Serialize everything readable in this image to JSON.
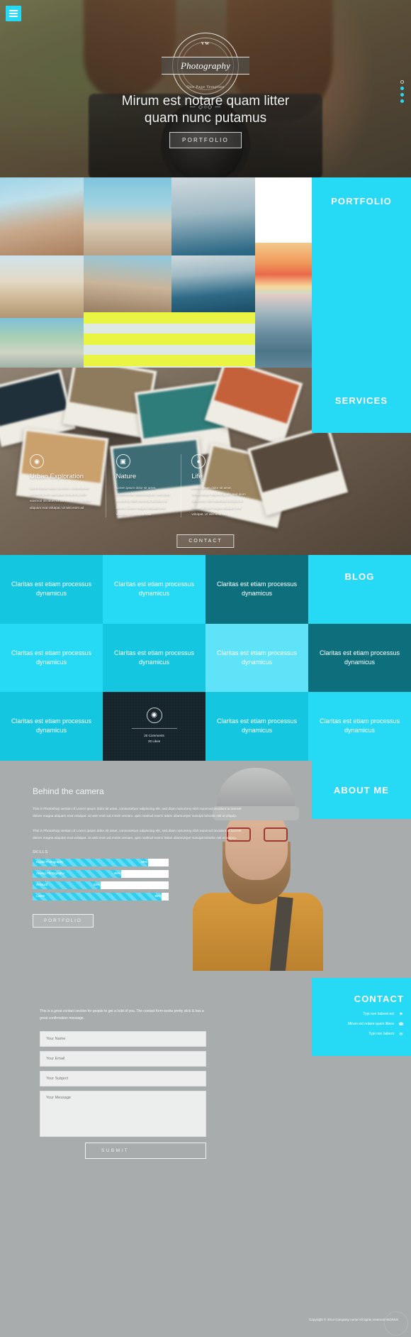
{
  "theme": {
    "accent": "#26d9f5",
    "accent_dark": "#0f8fa3",
    "dark_tile": "#16242c",
    "body_gray": "#a8acad"
  },
  "hero": {
    "menu_icon": "hamburger-icon",
    "badge": {
      "top_text": "VW",
      "name": "Photography",
      "sub_text": "One Page Template",
      "deco": "— ◇○◇ —"
    },
    "title_line1": "Mirum est notare quam litter",
    "title_line2": "quam nunc putamus",
    "cta_label": "PORTFOLIO"
  },
  "portfolio": {
    "label": "PORTFOLIO",
    "tiles": [
      {
        "name": "tile-friends-beach",
        "cls": "t-beach"
      },
      {
        "name": "tile-hat-girl",
        "cls": "t-hat"
      },
      {
        "name": "tile-longtail-boat",
        "cls": "t-boat"
      },
      {
        "name": "tile-running-friends",
        "cls": "t-run"
      },
      {
        "name": "tile-girls-running",
        "cls": "t-girls"
      },
      {
        "name": "tile-couple-boat",
        "cls": "t-boat"
      },
      {
        "name": "tile-sunset",
        "cls": "t-sunset"
      },
      {
        "name": "tile-blonde-rock",
        "cls": "t-blonde"
      },
      {
        "name": "tile-yellow-stripes",
        "cls": "t-stripes"
      },
      {
        "name": "tile-surfer",
        "cls": "t-surf"
      }
    ]
  },
  "services": {
    "label": "SERVICES",
    "cta_label": "CONTACT",
    "items": [
      {
        "icon": "camera-icon",
        "glyph": "◉",
        "title": "Urban Exploration",
        "text": "Lorem ipsum dolor sit amet, consectetuer adipiscing elit, sed diam nonummy nibh euismod tincidunt ut laoreet dolore magna aliquam erat volutpat. Ut wisi enim ad"
      },
      {
        "icon": "video-camera-icon",
        "glyph": "▣",
        "title": "Nature",
        "text": "Lorem ipsum dolor sit amet, consectetuer adipiscing elit, sed diam nonummy nibh euismod tincidunt ut laoreet dolore magna aliquam erat volutpat. Ut wisi enim ad"
      },
      {
        "icon": "person-icon",
        "glyph": "●",
        "title": "Life",
        "text": "Lorem ipsum dolor sit amet, consectetuer adipiscing elit, sed diam nonummy nibh euismod tincidunt ut laoreet dolore magna aliquam erat volutpat. Ut wisi enim ad"
      }
    ]
  },
  "blog": {
    "label": "BLOG",
    "post_text": "Claritas est etiam processus dynamicus",
    "featured": {
      "icon": "camera-icon",
      "glyph": "◉",
      "comments": "20 Comments",
      "likes": "20 Likes"
    },
    "cells": [
      {
        "text": "Claritas est etiam processus dynamicus",
        "bg": "#14c6e0"
      },
      {
        "text": "Claritas est etiam processus dynamicus",
        "bg": "#26d9f5"
      },
      {
        "text": "Claritas est etiam processus dynamicus",
        "bg": "#0d6f7c"
      },
      {
        "text": "BLOG",
        "bg": "#26d9f5",
        "kind": "title"
      },
      {
        "text": "Claritas est etiam processus dynamicus",
        "bg": "#26d9f5"
      },
      {
        "text": "Claritas est etiam processus dynamicus",
        "bg": "#14c6e0"
      },
      {
        "text": "Claritas est etiam processus dynamicus",
        "bg": "#5fe3f8"
      },
      {
        "text": "Claritas est etiam processus dynamicus",
        "bg": "#0d6f7c"
      },
      {
        "text": "Claritas est etiam processus dynamicus",
        "bg": "#14c6e0"
      },
      {
        "text": "",
        "bg": "#16242c",
        "kind": "featured"
      },
      {
        "text": "Claritas est etiam processus dynamicus",
        "bg": "#14c6e0"
      },
      {
        "text": "Claritas est etiam processus dynamicus",
        "bg": "#26d9f5"
      }
    ]
  },
  "about": {
    "label": "ABOUT ME",
    "heading": "Behind the camera",
    "para1": "This is Photoshop version of Lorem ipsum dolor sit amet, consectetuer adipiscing elit, sed diam nonummy nibh euismod tincidunt ut laoreet dolore magna aliquam erat volutpat. Ut wisi enim ad minim veniam, quis nostrud exerci tation ullamcorper suscipit lobortis nisl ut aliquip.",
    "para2": "This is Photoshop version of Lorem ipsum dolor sit amet, consectetuer adipiscing elit, sed diam nonummy nibh euismod tincidunt ut laoreet dolore magna aliquam erat volutpat. Ut wisi enim ad minim veniam, quis nostrud exerci tation ullamcorper suscipit lobortis nisl ut aliquip.",
    "skills_heading": "SKILLS",
    "skills": [
      {
        "name": "Digital Photography",
        "percent": "85%",
        "value": 85
      },
      {
        "name": "Analog Photography",
        "percent": "65%",
        "value": 65
      },
      {
        "name": "Retouch",
        "percent": "50%",
        "value": 50
      },
      {
        "name": "Lorem",
        "percent": "95%",
        "value": 95
      }
    ],
    "cta_label": "PORTFOLIO"
  },
  "contact": {
    "label": "CONTACT",
    "details": [
      {
        "text": "Typi non habent est",
        "icon": "location-pin-icon",
        "glyph": "⚑"
      },
      {
        "text": "Mirum est notare quam littera",
        "icon": "phone-icon",
        "glyph": "☎"
      },
      {
        "text": "Typi non habent",
        "icon": "envelope-icon",
        "glyph": "✉"
      }
    ],
    "intro": "This is a great contact section for people to get a hold of you. The contact form works pretty slick & has a great confirmation message.",
    "fields": [
      {
        "name": "name-field",
        "placeholder": "Your Name",
        "value": ""
      },
      {
        "name": "email-field",
        "placeholder": "Your Email",
        "value": ""
      },
      {
        "name": "subject-field",
        "placeholder": "Your Subject",
        "value": ""
      }
    ],
    "message_placeholder": "Your Message",
    "message_value": "",
    "submit_label": "SUBMIT",
    "copyright": "Copyright © 2014 Company name All rights reserved WORKS"
  }
}
